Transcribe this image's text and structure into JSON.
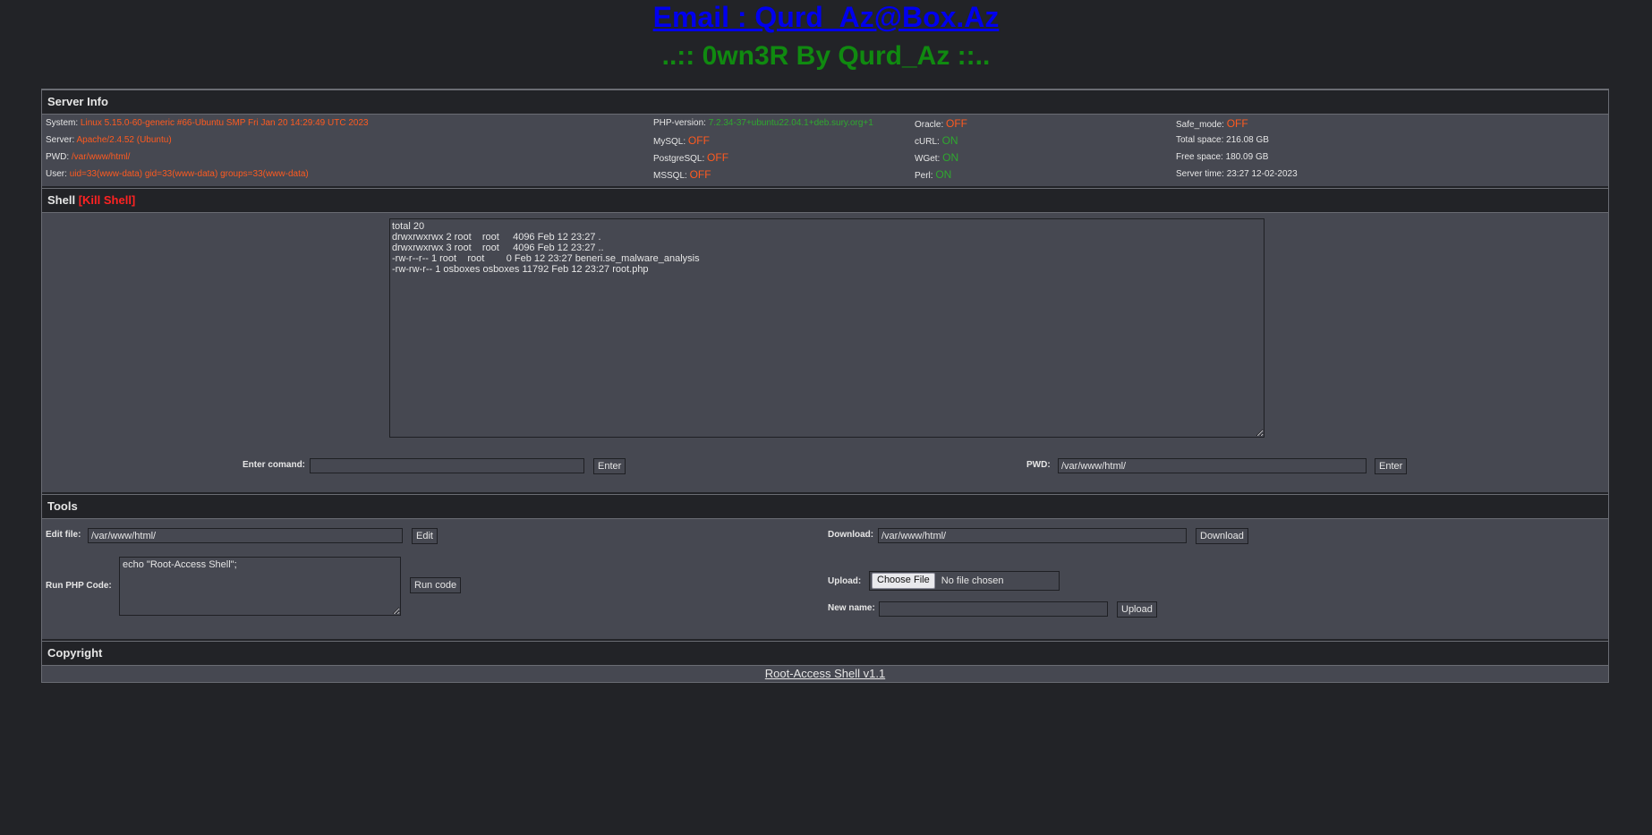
{
  "header": {
    "email": "Email : Qurd_Az@Box.Az",
    "owner": "..:: 0wn3R By Qurd_Az ::.."
  },
  "server_info": {
    "title": "Server Info",
    "system": {
      "label": "System:",
      "value": "Linux 5.15.0-60-generic #66-Ubuntu SMP Fri Jan 20 14:29:49 UTC 2023"
    },
    "server": {
      "label": "Server:",
      "value": "Apache/2.4.52 (Ubuntu)"
    },
    "pwd": {
      "label": "PWD:",
      "value": "/var/www/html/"
    },
    "user": {
      "label": "User:",
      "value": "uid=33(www-data) gid=33(www-data) groups=33(www-data)"
    },
    "php_version": {
      "label": "PHP-version:",
      "value": "7.2.34-37+ubuntu22.04.1+deb.sury.org+1"
    },
    "mysql": {
      "label": "MySQL:",
      "value": "OFF"
    },
    "postgresql": {
      "label": "PostgreSQL:",
      "value": "OFF"
    },
    "mssql": {
      "label": "MSSQL:",
      "value": "OFF"
    },
    "oracle": {
      "label": "Oracle:",
      "value": "OFF"
    },
    "curl": {
      "label": "cURL:",
      "value": "ON"
    },
    "wget": {
      "label": "WGet:",
      "value": "ON"
    },
    "perl": {
      "label": "Perl:",
      "value": "ON"
    },
    "safe_mode": {
      "label": "Safe_mode:",
      "value": "OFF"
    },
    "total_space": {
      "label": "Total space:",
      "value": "216.08 GB"
    },
    "free_space": {
      "label": "Free space:",
      "value": "180.09 GB"
    },
    "server_time": {
      "label": "Server time:",
      "value": "23:27 12-02-2023"
    }
  },
  "shell": {
    "title": "Shell",
    "kill_label": "[Kill Shell]",
    "output": "total 20\ndrwxrwxrwx 2 root    root     4096 Feb 12 23:27 .\ndrwxrwxrwx 3 root    root     4096 Feb 12 23:27 ..\n-rw-r--r-- 1 root    root        0 Feb 12 23:27 beneri.se_malware_analysis\n-rw-rw-r-- 1 osboxes osboxes 11792 Feb 12 23:27 root.php",
    "command_label": "Enter comand:",
    "command_value": "",
    "command_button": "Enter",
    "pwd_label": "PWD:",
    "pwd_value": "/var/www/html/",
    "pwd_button": "Enter"
  },
  "tools": {
    "title": "Tools",
    "edit_label": "Edit file:",
    "edit_value": "/var/www/html/",
    "edit_button": "Edit",
    "download_label": "Download:",
    "download_value": "/var/www/html/",
    "download_button": "Download",
    "php_label": "Run PHP Code:",
    "php_value": "echo \"Root-Access Shell\";",
    "php_button": "Run code",
    "upload_label": "Upload:",
    "choose_file": "Choose File",
    "no_file": "No file chosen",
    "new_name_label": "New name:",
    "new_name_value": "",
    "upload_button": "Upload"
  },
  "copyright": {
    "title": "Copyright",
    "link": "Root-Access Shell v1.1"
  },
  "colors": {
    "background": "#222327",
    "panel": "#464851",
    "off": "#ff5a1f",
    "on": "#2fa82f",
    "link": "#0000ee",
    "owner": "#108a10",
    "kill": "#ff2222"
  }
}
